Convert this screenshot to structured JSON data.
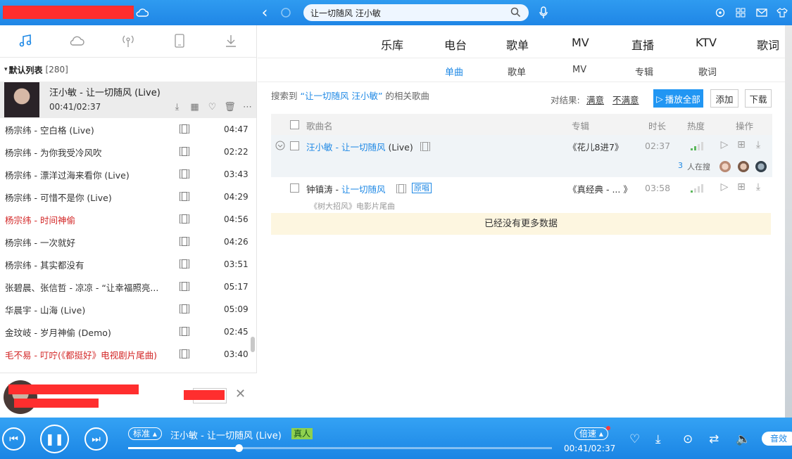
{
  "topbar": {
    "search_value": "让一切随风 汪小敏",
    "back_icon": "‹",
    "icons": [
      "refresh-icon",
      "search-icon",
      "mic-icon",
      "settings-icon",
      "apps-icon",
      "mail-icon",
      "skin-icon"
    ]
  },
  "left": {
    "tabs": [
      "music-note-icon",
      "cloud-icon",
      "radio-icon",
      "device-icon",
      "download-icon"
    ],
    "list_title": "默认列表",
    "list_count": "[280]",
    "now_playing": {
      "title": "汪小敏 - 让一切随风 (Live)",
      "time": "00:41/02:37"
    },
    "songs": [
      {
        "name": "杨宗纬 - 空白格 (Live)",
        "duration": "04:47",
        "red": false
      },
      {
        "name": "杨宗纬 - 为你我受冷风吹",
        "duration": "02:22",
        "red": false
      },
      {
        "name": "杨宗纬 - 漂洋过海来看你 (Live)",
        "duration": "03:43",
        "red": false
      },
      {
        "name": "杨宗纬 - 可惜不是你 (Live)",
        "duration": "04:29",
        "red": false
      },
      {
        "name": "杨宗纬 - 时间神偷",
        "duration": "04:56",
        "red": true
      },
      {
        "name": "杨宗纬 - 一次就好",
        "duration": "04:26",
        "red": false
      },
      {
        "name": "杨宗纬 - 其实都没有",
        "duration": "03:51",
        "red": false
      },
      {
        "name": "张碧晨、张信哲 - 凉凉 - “让幸福照亮...",
        "duration": "05:17",
        "red": false
      },
      {
        "name": "华晨宇 - 山海 (Live)",
        "duration": "05:09",
        "red": false
      },
      {
        "name": "金玟岐 - 岁月神偷 (Demo)",
        "duration": "02:45",
        "red": false
      },
      {
        "name": "毛不易 - 叮咛(《都挺好》电视剧片尾曲)",
        "duration": "03:40",
        "red": true
      }
    ]
  },
  "nav": {
    "items": [
      "乐库",
      "电台",
      "歌单",
      "MV",
      "直播",
      "KTV",
      "歌词"
    ],
    "sub": [
      "单曲",
      "歌单",
      "MV",
      "专辑",
      "歌词"
    ]
  },
  "results": {
    "prefix": "搜索到",
    "query": "“让一切随风 汪小敏”",
    "suffix": "的相关歌曲",
    "feedback_label": "对结果:",
    "satisfied": "满意",
    "unsatisfied": "不满意",
    "play_all": "播放全部",
    "add": "添加",
    "download": "下载"
  },
  "table": {
    "headers": {
      "name": "歌曲名",
      "album": "专辑",
      "duration": "时长",
      "heat": "热度",
      "ops": "操作"
    },
    "rows": [
      {
        "singer": "汪小敏",
        "sep": " - ",
        "song": "让一切随风",
        "suffix": " (Live)",
        "album": "《花儿8进7》",
        "duration": "02:37",
        "heat": 0.5,
        "searching_count": "3",
        "searching_label": "人在搜"
      },
      {
        "singer": "钟镇涛",
        "sep": " - ",
        "song": "让一切随风",
        "tag": "原唱",
        "note": "《树大招风》电影片尾曲",
        "album": "《真经典 - ... 》",
        "duration": "03:58",
        "heat": 0.2
      }
    ],
    "no_more": "已经没有更多数据"
  },
  "player": {
    "quality": "标准",
    "title": "汪小敏 - 让一切随风 (Live)",
    "badge": "真人",
    "speed": "倍速",
    "time": "00:41/02:37",
    "progress": 0.26,
    "eq_label": "音效",
    "accent": "#1e88e5"
  }
}
